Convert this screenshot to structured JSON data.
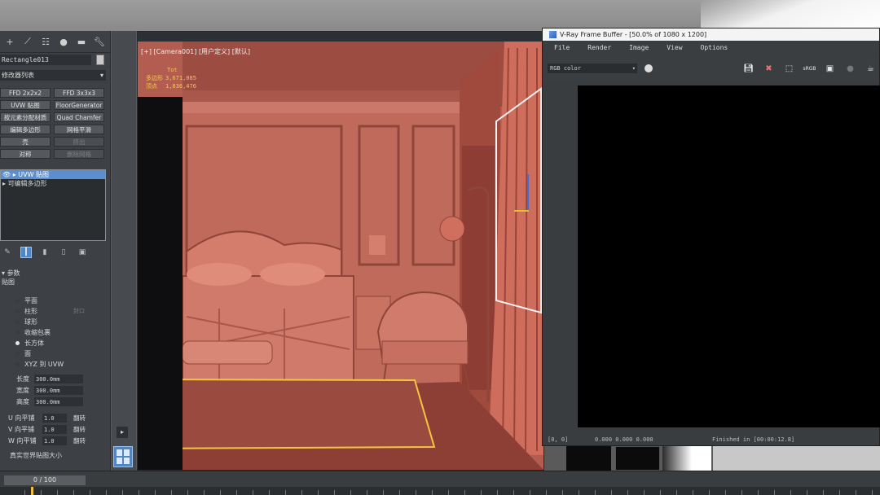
{
  "command_panel": {
    "top_icons": [
      "add-icon",
      "modify-icon",
      "hierarchy-icon",
      "motion-icon",
      "display-icon",
      "utilities-icon"
    ],
    "object_name": "Rectangle013",
    "modifier_list": "修改器列表",
    "buttons": [
      {
        "label": "FFD 2x2x2",
        "enabled": true
      },
      {
        "label": "FFD 3x3x3",
        "enabled": true
      },
      {
        "label": "UVW 贴图",
        "enabled": true
      },
      {
        "label": "FloorGenerator",
        "enabled": true
      },
      {
        "label": "按元素分配材质",
        "enabled": true
      },
      {
        "label": "Quad Chamfer",
        "enabled": true
      },
      {
        "label": "编辑多边形",
        "enabled": true
      },
      {
        "label": "网格平滑",
        "enabled": true
      },
      {
        "label": "壳",
        "enabled": true
      },
      {
        "label": "挤出",
        "enabled": false
      },
      {
        "label": "对称",
        "enabled": true
      },
      {
        "label": "删除网格",
        "enabled": false
      }
    ],
    "stack": [
      {
        "label": "UVW 贴图",
        "selected": true
      },
      {
        "label": "可编辑多边形",
        "selected": false
      }
    ],
    "params_title": "参数",
    "mapping_label": "贴图",
    "mapping_options": [
      {
        "label": "平面",
        "selected": false
      },
      {
        "label": "柱形",
        "selected": false
      },
      {
        "label": "球形",
        "selected": false
      },
      {
        "label": "收缩包裹",
        "selected": false
      },
      {
        "label": "长方体",
        "selected": true
      },
      {
        "label": "面",
        "selected": false
      },
      {
        "label": "XYZ 到 UVW",
        "selected": false
      }
    ],
    "cap_label": "封口",
    "dims": [
      {
        "label": "长度",
        "value": "300.0mm"
      },
      {
        "label": "宽度",
        "value": "300.0mm"
      },
      {
        "label": "高度",
        "value": "300.0mm"
      }
    ],
    "tiles": [
      {
        "label": "U 向平铺",
        "value": "1.0",
        "flip": "翻转"
      },
      {
        "label": "V 向平铺",
        "value": "1.0",
        "flip": "翻转"
      },
      {
        "label": "W 向平铺",
        "value": "1.0",
        "flip": "翻转"
      }
    ],
    "real_world_label": "真实世界贴图大小"
  },
  "viewport": {
    "label": "[+] [Camera001] [用户定义] [默认]",
    "stats": {
      "header": "Tot",
      "polys_label": "多边形",
      "polys": "3,671,085",
      "verts_label": "顶点",
      "verts": "1,836,476"
    }
  },
  "vfb": {
    "title": "V-Ray Frame Buffer - [50.0% of 1080 x 1200]",
    "menu": [
      "File",
      "Render",
      "Image",
      "View",
      "Options"
    ],
    "channel": "RGB color",
    "toolbar_icons": [
      "save-icon",
      "clear-icon",
      "region-icon",
      "srgb-icon",
      "history-icon",
      "render-icon"
    ],
    "toolbar_srgb": "sRGB",
    "status_coords": "[0, 0]",
    "status_values": "0.000   0.000   0.000",
    "status_right": "Finished in [00:00:12.8]"
  },
  "timeline": {
    "frame": "0 / 100"
  },
  "colors": {
    "viewport_bg": "#b35d50",
    "panel_bg": "#3d4145",
    "selection": "#5c8fd0",
    "stats": "#f2c94c",
    "rug_outline": "#f5c542"
  }
}
